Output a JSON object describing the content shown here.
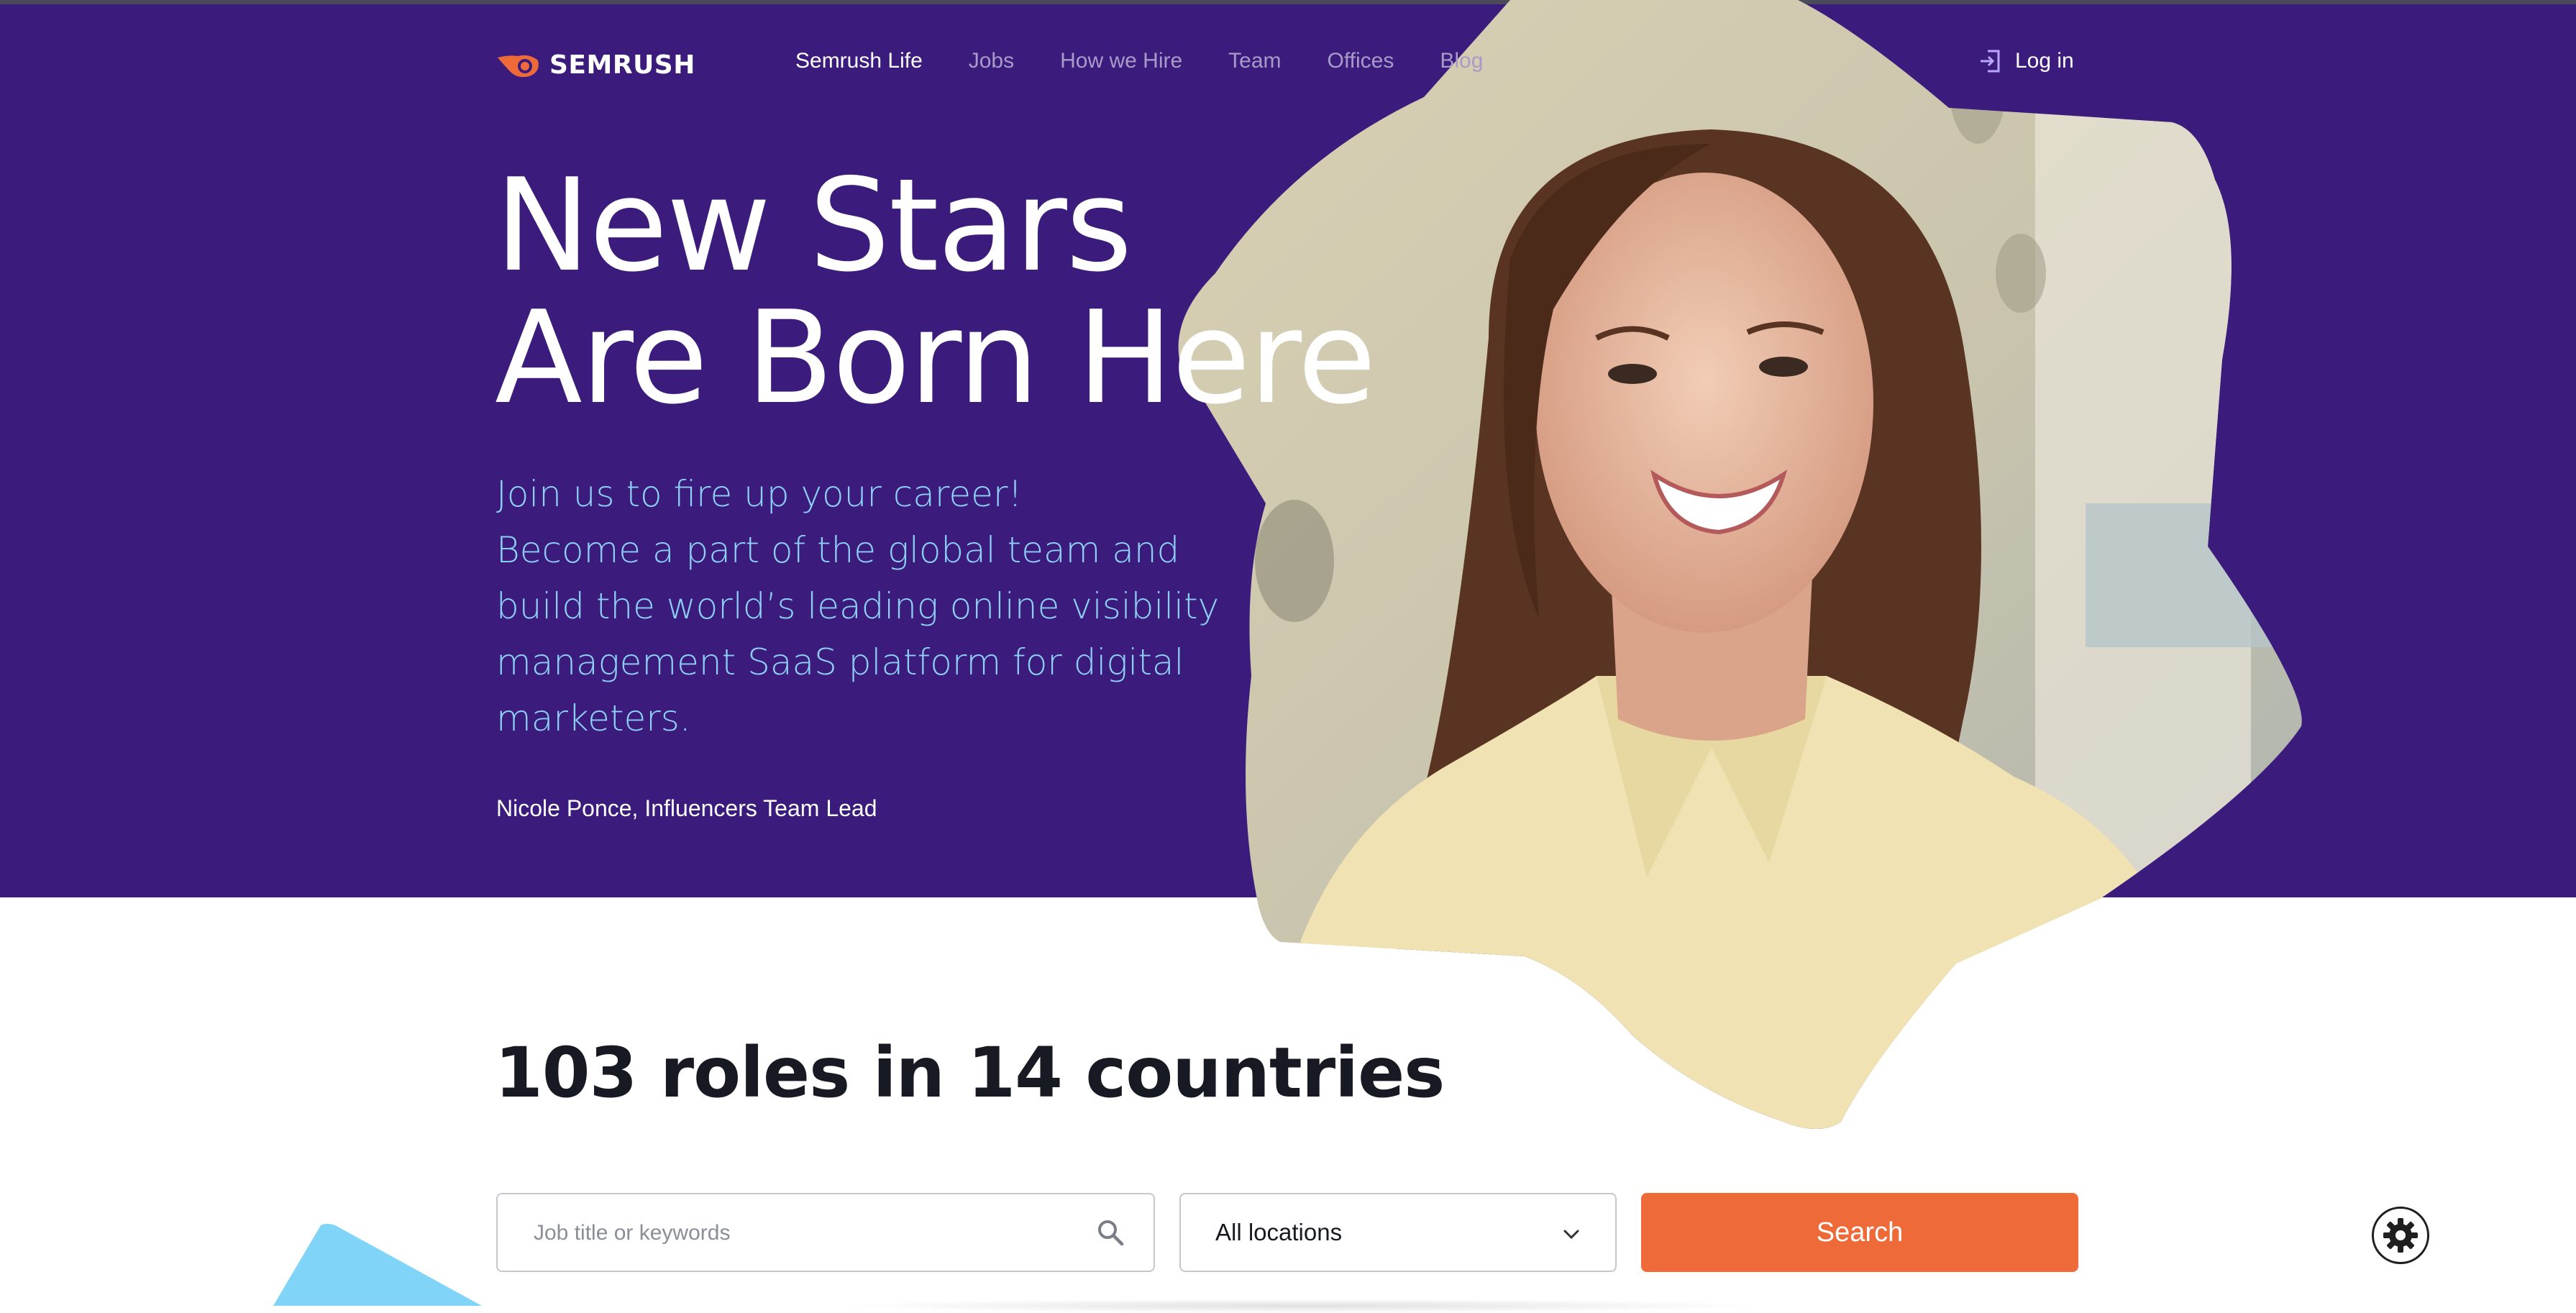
{
  "brand": {
    "name": "SEMRUSH",
    "accent": "#ef6a39",
    "hero_bg": "#3b1c7c",
    "sub_color": "#8ecff6"
  },
  "nav": {
    "items": [
      {
        "label": "Semrush Life",
        "active": true
      },
      {
        "label": "Jobs",
        "active": false
      },
      {
        "label": "How we Hire",
        "active": false
      },
      {
        "label": "Team",
        "active": false
      },
      {
        "label": "Offices",
        "active": false
      },
      {
        "label": "Blog",
        "active": false
      }
    ],
    "login_label": "Log in",
    "login_icon": "login-icon"
  },
  "hero": {
    "headline_lines": [
      "New Stars",
      "Are Born Here"
    ],
    "sub_lines": [
      "Join us to fire up your career!",
      "Become a part of the global team and",
      "build the world’s leading online visibility",
      "management SaaS platform for digital",
      "marketers."
    ],
    "caption": "Nicole Ponce, Influencers Team Lead",
    "portrait_icon": "portrait-photo"
  },
  "jobs": {
    "title": "103 roles in 14 countries",
    "search_placeholder": "Job title or keywords",
    "search_value": "",
    "location_selected": "All locations",
    "search_button": "Search"
  },
  "widgets": {
    "settings_icon": "gear-icon"
  }
}
